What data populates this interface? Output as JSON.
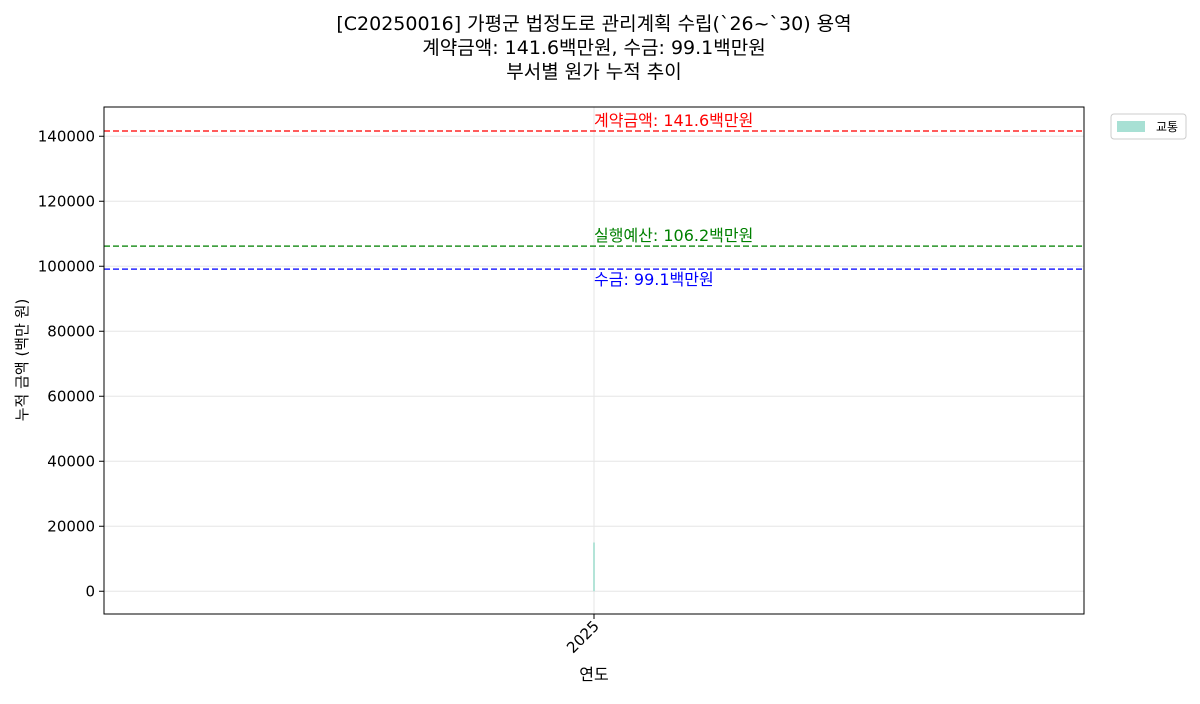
{
  "chart_data": {
    "type": "area",
    "title": "[C20250016] 가평군 법정도로 관리계획 수립(`26~`30) 용역",
    "subtitle_1": "계약금액: 141.6백만원, 수금: 99.1백만원",
    "subtitle_2": "부서별 원가 누적 추이",
    "xlabel": "연도",
    "ylabel": "누적 금액 (백만 원)",
    "x": [
      "2025"
    ],
    "series": [
      {
        "name": "교통",
        "values": [
          15000
        ],
        "color": "#a8e0d4"
      }
    ],
    "ylim": [
      -7000,
      149000
    ],
    "yticks": [
      0,
      20000,
      40000,
      60000,
      80000,
      100000,
      120000,
      140000
    ],
    "grid": true,
    "legend_position": "outside-top-right",
    "reference_lines": [
      {
        "label": "계약금액: 141.6백만원",
        "value": 141600,
        "color": "#ff0000",
        "label_position": "above"
      },
      {
        "label": "실행예산: 106.2백만원",
        "value": 106200,
        "color": "#008000",
        "label_position": "above"
      },
      {
        "label": "수금: 99.1백만원",
        "value": 99100,
        "color": "#0000ff",
        "label_position": "below"
      }
    ]
  }
}
